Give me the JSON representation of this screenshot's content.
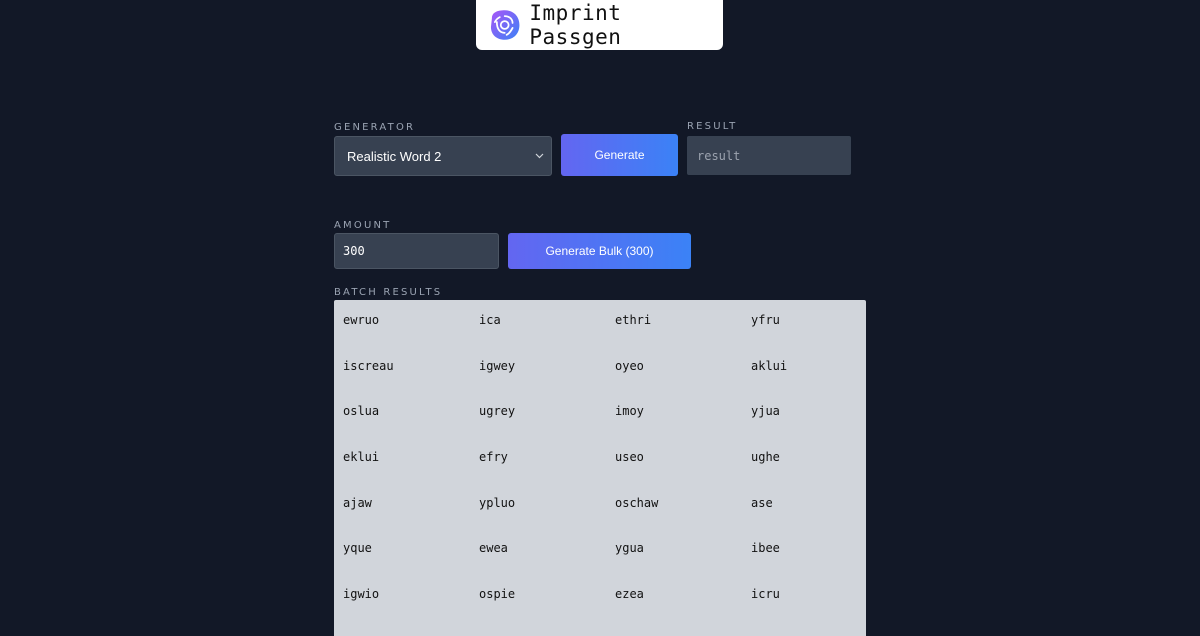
{
  "brand": {
    "name": "Imprint Passgen",
    "logo_icon": "imprint-logo-icon"
  },
  "generator": {
    "label": "GENERATOR",
    "selected": "Realistic Word 2",
    "chevron_icon": "chevron-down-icon",
    "button_label": "Generate"
  },
  "result": {
    "label": "RESULT",
    "placeholder": "result"
  },
  "amount": {
    "label": "AMOUNT",
    "value": "300",
    "button_label": "Generate Bulk (300)"
  },
  "batch": {
    "label": "BATCH RESULTS",
    "rows": [
      [
        "ewruo",
        "ica",
        "ethri",
        "yfru"
      ],
      [
        "iscreau",
        "igwey",
        "oyeo",
        "aklui"
      ],
      [
        "oslua",
        "ugrey",
        "imoy",
        "yjua"
      ],
      [
        "eklui",
        "efry",
        "useo",
        "ughe"
      ],
      [
        "ajaw",
        "ypluo",
        "oschaw",
        "ase"
      ],
      [
        "yque",
        "ewea",
        "ygua",
        "ibee"
      ],
      [
        "igwio",
        "ospie",
        "ezea",
        "icru"
      ]
    ]
  },
  "colors": {
    "background": "#121827",
    "panel": "#374151",
    "accent_start": "#6366f1",
    "accent_end": "#3b82f6",
    "batch_bg": "#d1d5db"
  }
}
